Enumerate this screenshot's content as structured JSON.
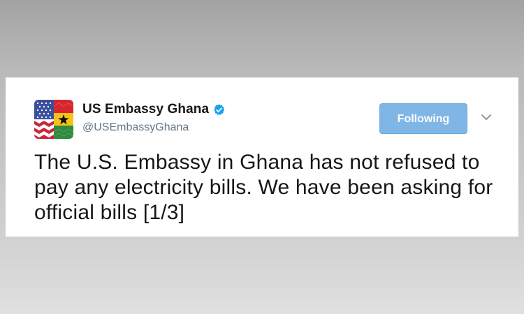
{
  "tweet": {
    "author": {
      "display_name": "US Embassy Ghana",
      "handle": "@USEmbassyGhana",
      "verified": true,
      "avatar_icon": "us-ghana-flag-avatar"
    },
    "follow_button": {
      "label": "Following",
      "color": "#7fb6e6"
    },
    "menu_icon": "chevron-down-icon",
    "text": "The U.S. Embassy in Ghana has not refused to pay any electricity bills. We have been asking for official bills [1/3]"
  },
  "colors": {
    "verified_badge": "#1da1f2",
    "text": "#14171a",
    "handle": "#657786"
  }
}
